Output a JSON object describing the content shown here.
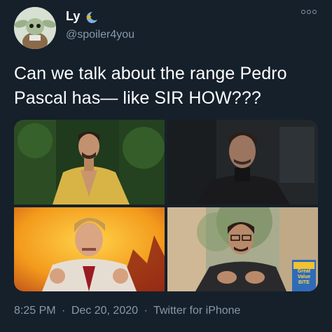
{
  "author": {
    "display_name": "Ly",
    "handle": "@spoiler4you",
    "badge_icon": "sun-moon-emoji-icon"
  },
  "tweet": {
    "text": "Can we talk about the range Pedro Pascal has— like SIR HOW???"
  },
  "media": {
    "tiles": [
      {
        "scene": "man-in-yellow-robe-forest"
      },
      {
        "scene": "man-in-dark-sweater"
      },
      {
        "scene": "man-in-suit-fire-background"
      },
      {
        "scene": "man-in-glasses-outdoors"
      }
    ],
    "cereal_box_text": "Great Value BITE"
  },
  "meta": {
    "time": "8:25 PM",
    "separator": "·",
    "date": "Dec 20, 2020",
    "source": "Twitter for iPhone"
  },
  "colors": {
    "background": "#15202b",
    "secondary_text": "#8899a6",
    "primary_text": "#ffffff"
  }
}
